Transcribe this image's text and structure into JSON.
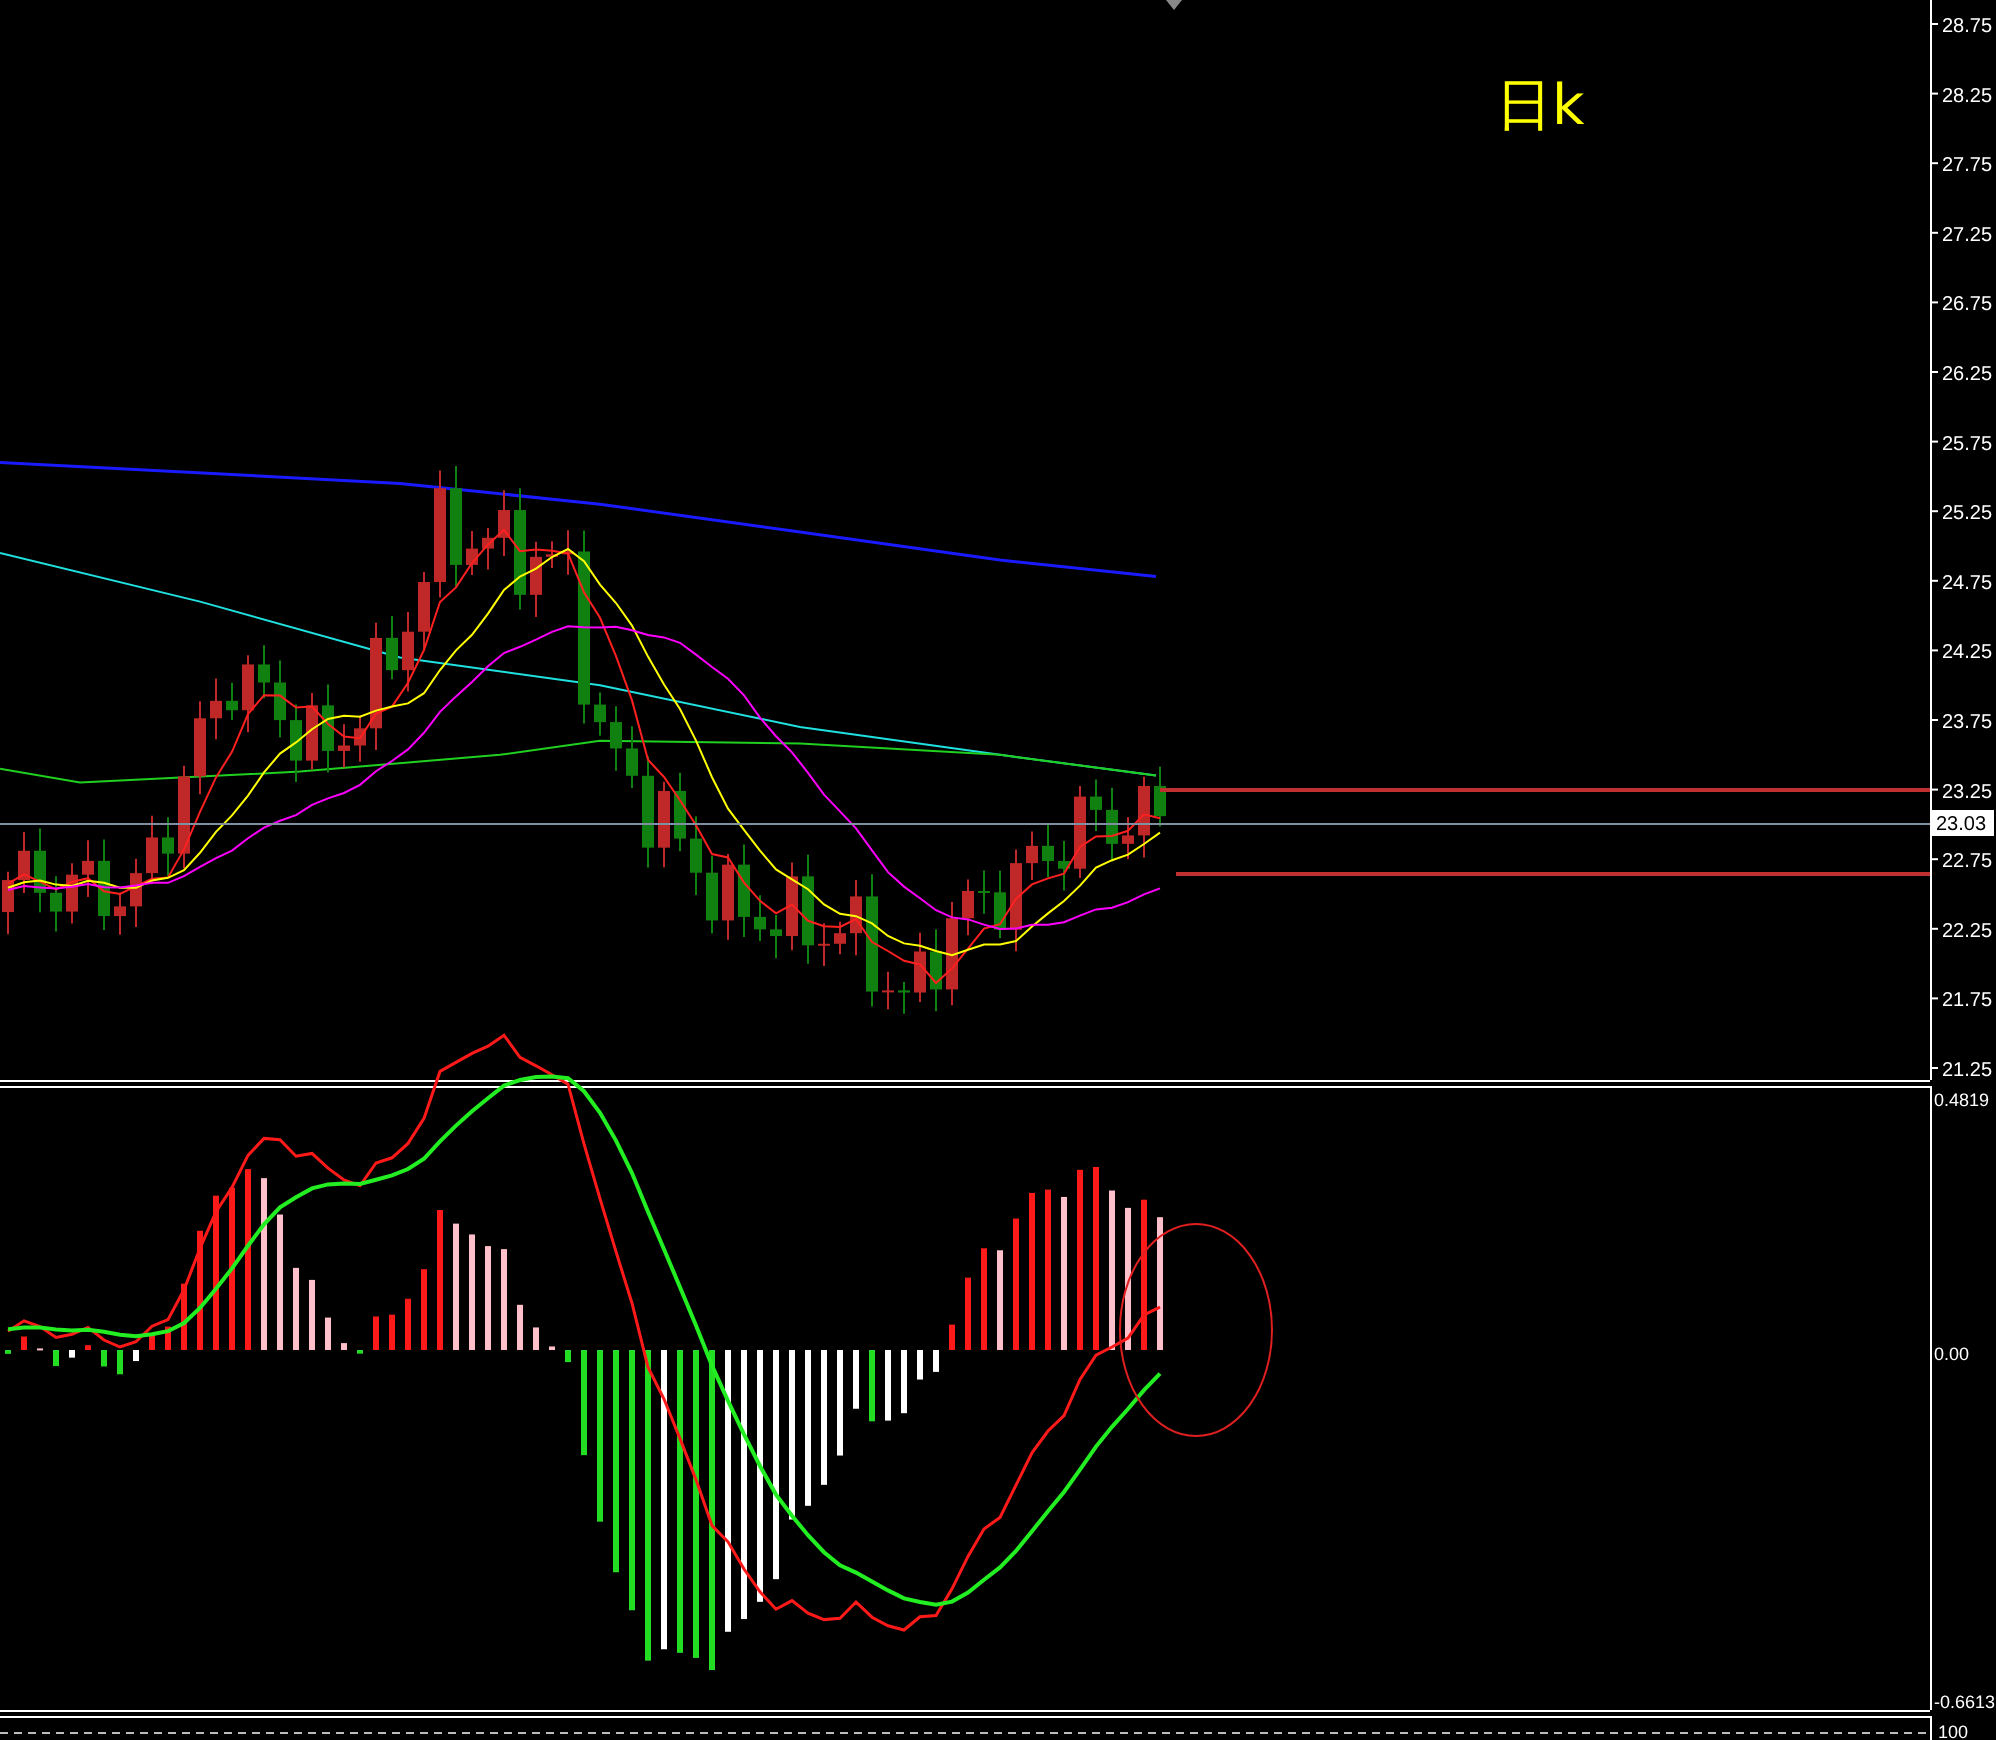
{
  "chart_title": "日k",
  "price_axis": [
    "28.75",
    "28.25",
    "27.75",
    "27.25",
    "26.75",
    "26.25",
    "25.75",
    "25.25",
    "24.75",
    "24.25",
    "23.75",
    "23.25",
    "22.75",
    "22.25",
    "21.75",
    "21.25"
  ],
  "current_price": "23.03",
  "macd_axis": [
    "0.4819",
    "0.00",
    "-0.6613"
  ],
  "lower_panel_axis": "100"
}
